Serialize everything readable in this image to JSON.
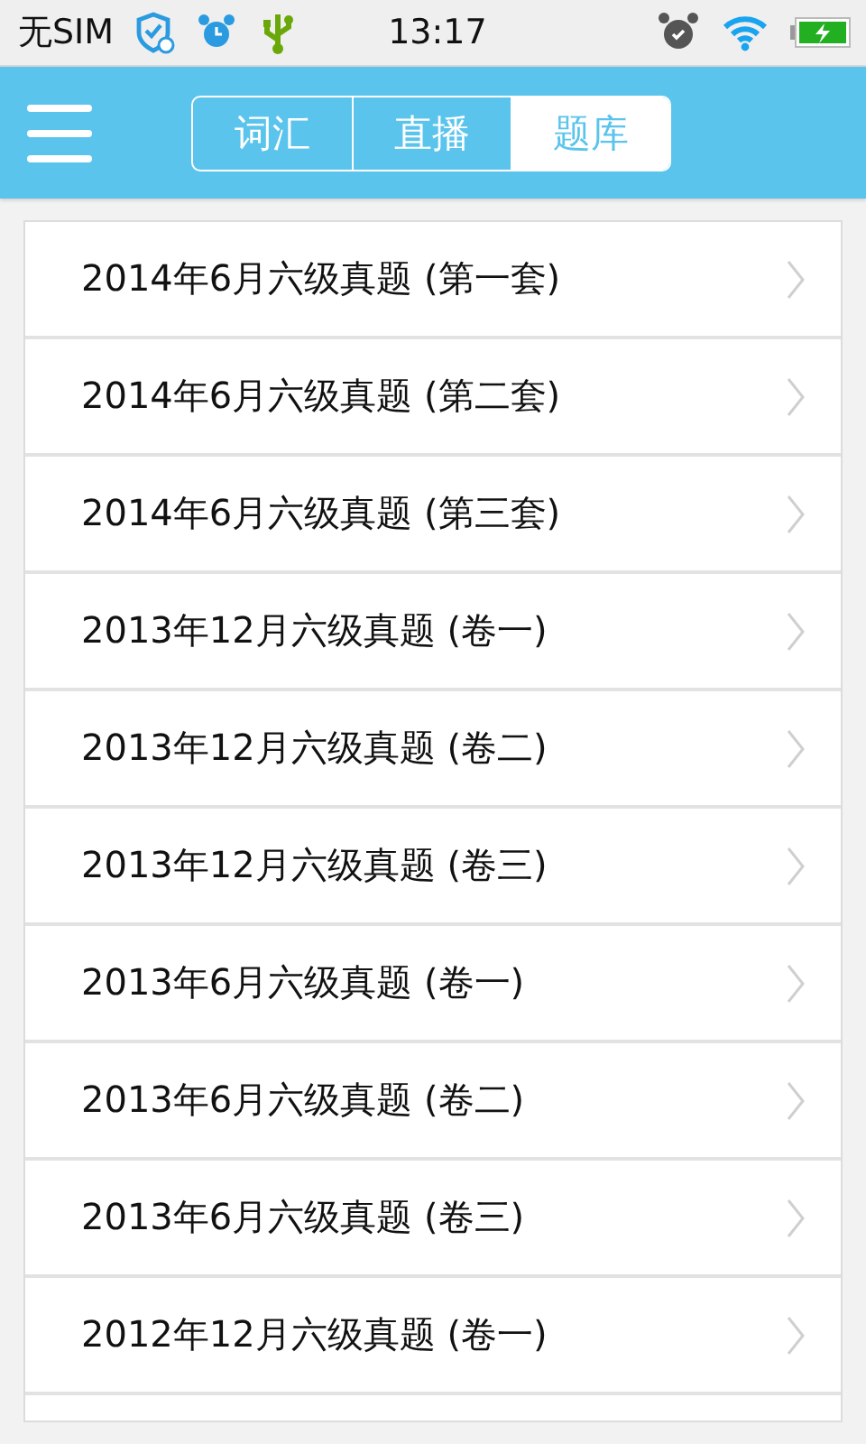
{
  "status_bar": {
    "carrier": "无SIM",
    "time": "13:17"
  },
  "tabs": [
    {
      "label": "词汇",
      "selected": false
    },
    {
      "label": "直播",
      "selected": false
    },
    {
      "label": "题库",
      "selected": true
    }
  ],
  "exams": [
    {
      "title": "2014年6月六级真题 (第一套)"
    },
    {
      "title": "2014年6月六级真题 (第二套)"
    },
    {
      "title": "2014年6月六级真题 (第三套)"
    },
    {
      "title": "2013年12月六级真题 (卷一)"
    },
    {
      "title": "2013年12月六级真题 (卷二)"
    },
    {
      "title": "2013年12月六级真题 (卷三)"
    },
    {
      "title": "2013年6月六级真题 (卷一)"
    },
    {
      "title": "2013年6月六级真题 (卷二)"
    },
    {
      "title": "2013年6月六级真题 (卷三)"
    },
    {
      "title": "2012年12月六级真题 (卷一)"
    }
  ]
}
